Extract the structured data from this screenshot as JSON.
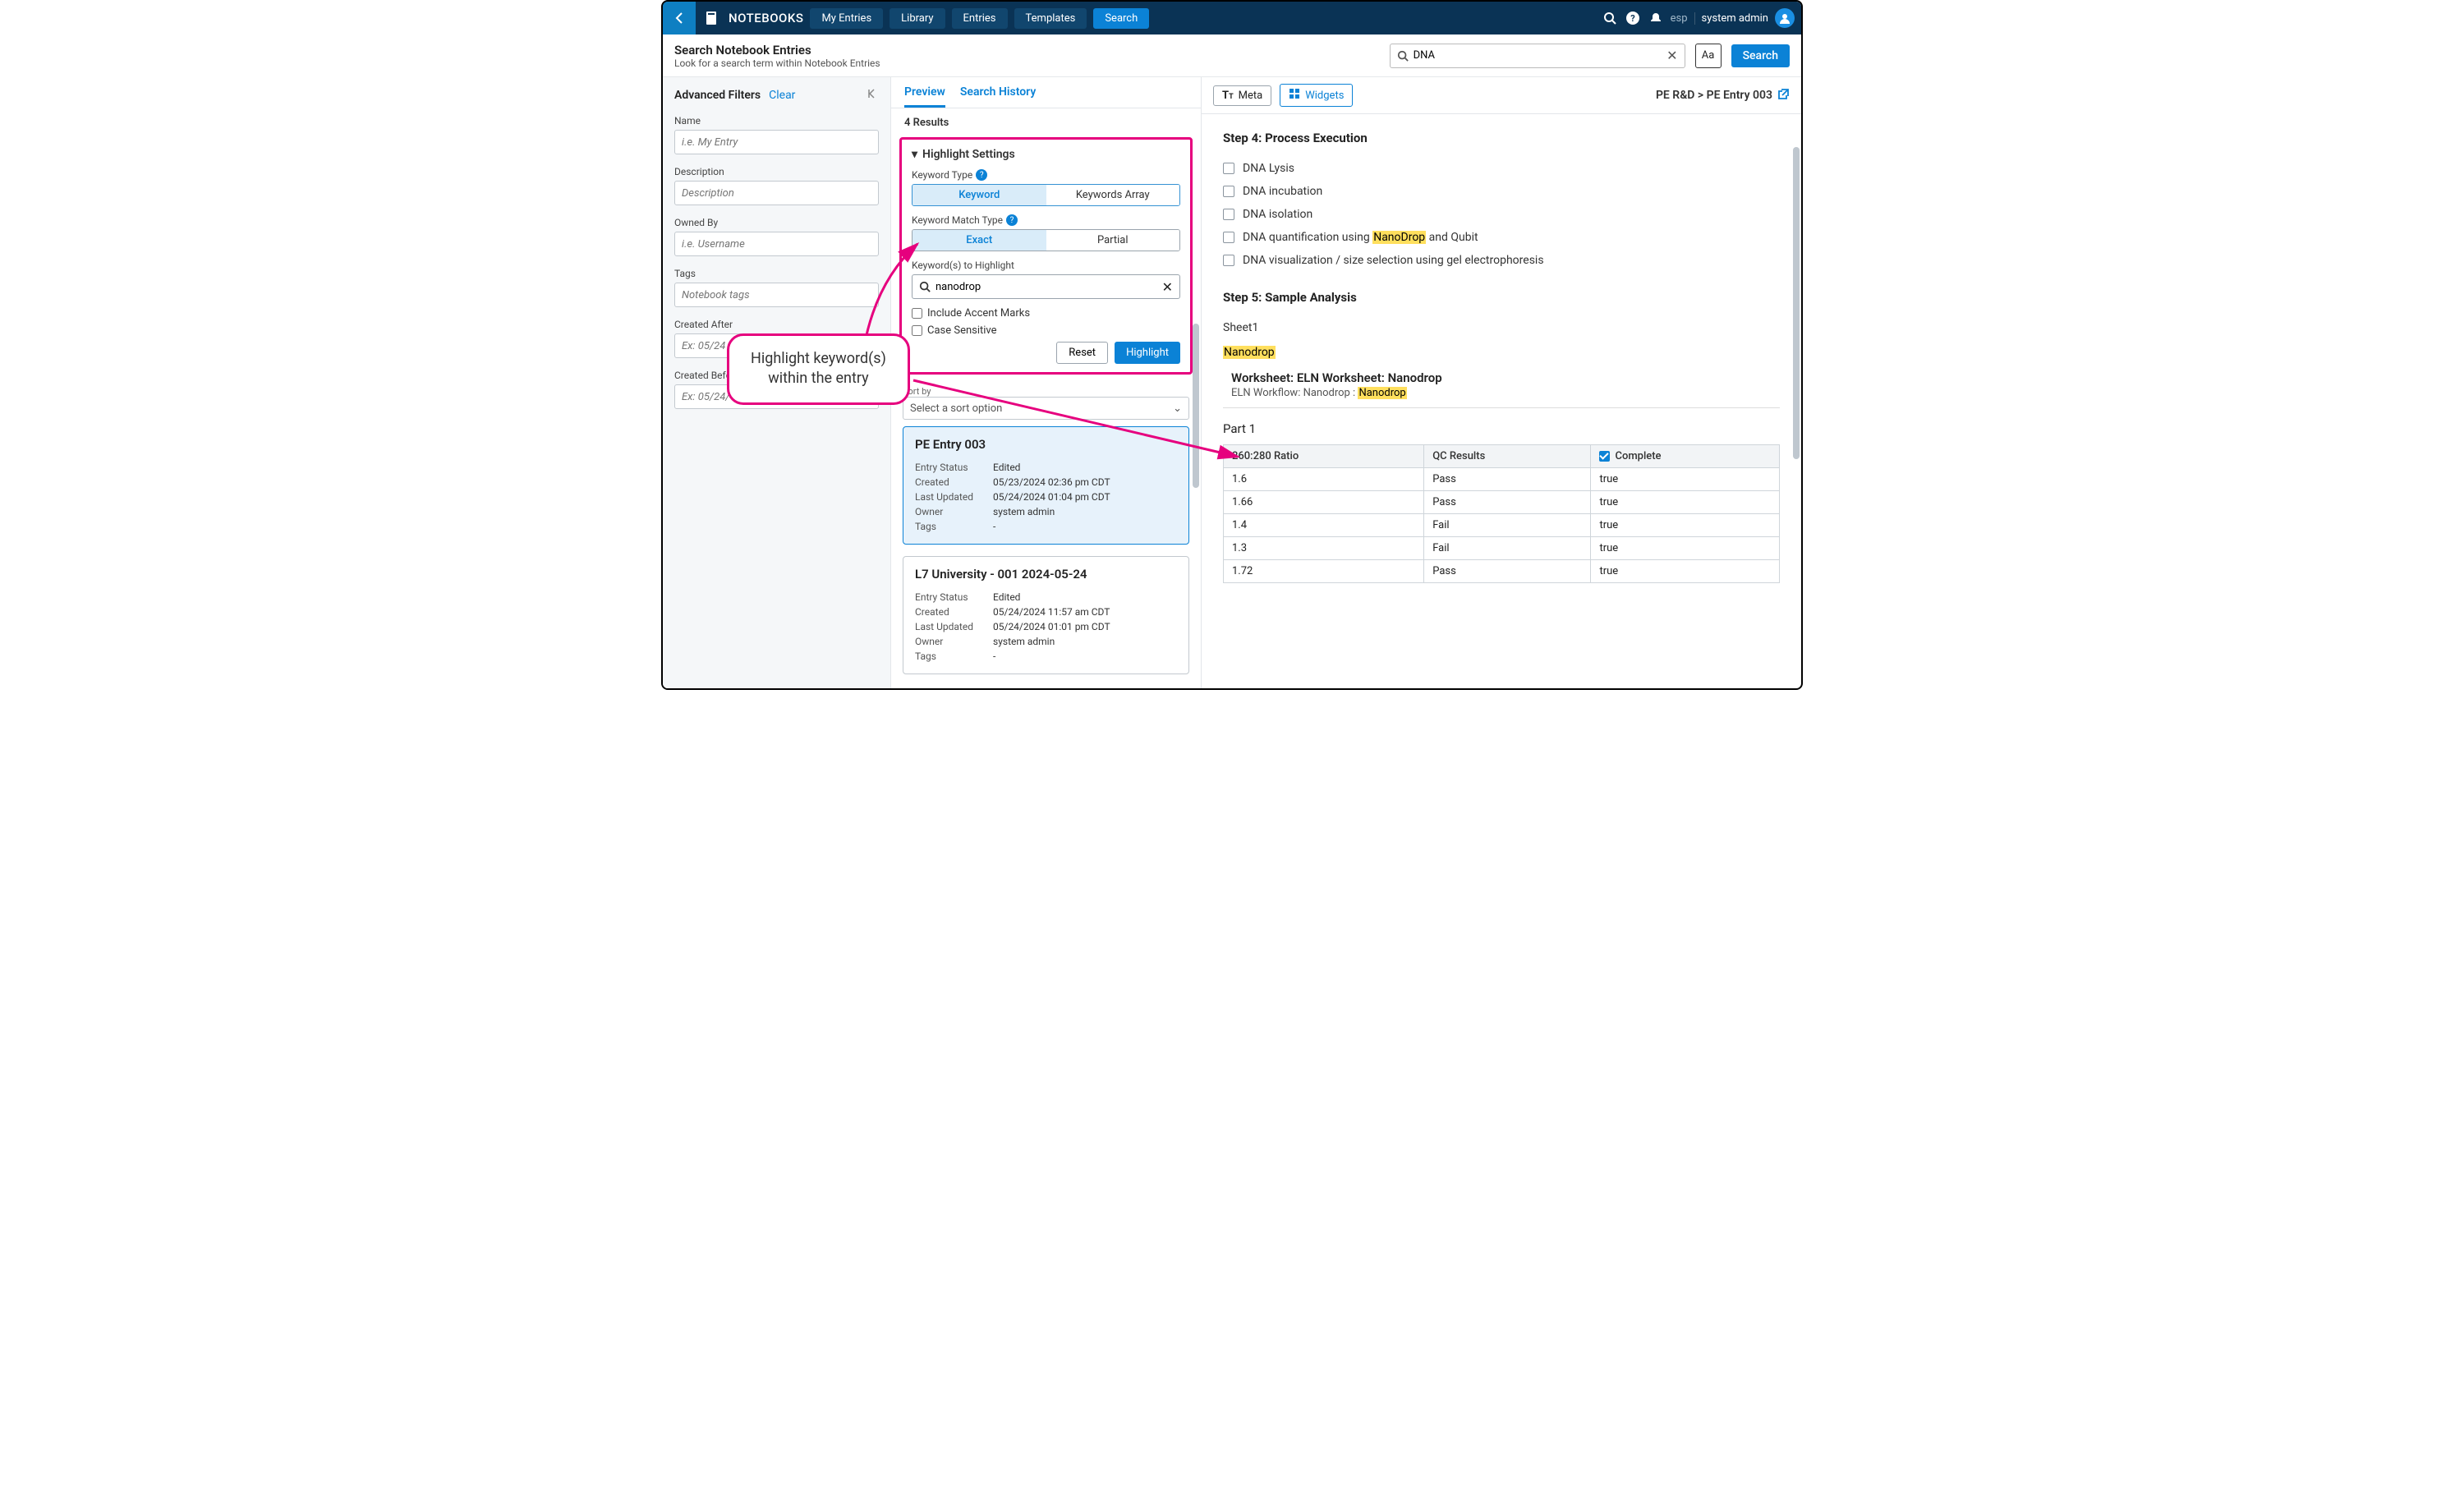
{
  "nav": {
    "brand": "NOTEBOOKS",
    "my_entries": "My Entries",
    "library": "Library",
    "entries": "Entries",
    "templates": "Templates",
    "search": "Search",
    "user_tag": "esp",
    "user_name": "system admin"
  },
  "header": {
    "title": "Search Notebook Entries",
    "sub": "Look for a search term within Notebook Entries",
    "search_value": "DNA",
    "aa": "Aa",
    "search_btn": "Search"
  },
  "filters": {
    "title": "Advanced Filters",
    "clear": "Clear",
    "name_label": "Name",
    "name_ph": "i.e. My Entry",
    "desc_label": "Description",
    "desc_ph": "Description",
    "owned_label": "Owned By",
    "owned_ph": "i.e. Username",
    "tags_label": "Tags",
    "tags_ph": "Notebook tags",
    "created_after_label": "Created After",
    "created_after_ph": "Ex: 05/24",
    "created_before_label": "Created Before",
    "created_before_ph": "Ex: 05/24/"
  },
  "tabs": {
    "preview": "Preview",
    "history": "Search History"
  },
  "results_count": "4 Results",
  "hl": {
    "title": "Highlight Settings",
    "kw_type_label": "Keyword Type",
    "kw": "Keyword",
    "kw_arr": "Keywords Array",
    "match_label": "Keyword Match Type",
    "exact": "Exact",
    "partial": "Partial",
    "to_hl_label": "Keyword(s) to Highlight",
    "to_hl_value": "nanodrop",
    "accent": "Include Accent Marks",
    "case": "Case Sensitive",
    "reset": "Reset",
    "highlight": "Highlight"
  },
  "sort": {
    "label": "Sort by",
    "placeholder": "Select a sort option"
  },
  "cards": [
    {
      "title": "PE Entry 003",
      "rows": [
        [
          "Entry Status",
          "Edited"
        ],
        [
          "Created",
          "05/23/2024 02:36 pm CDT"
        ],
        [
          "Last Updated",
          "05/24/2024 01:04 pm CDT"
        ],
        [
          "Owner",
          "system admin"
        ],
        [
          "Tags",
          "-"
        ]
      ]
    },
    {
      "title": "L7 University - 001 2024-05-24",
      "rows": [
        [
          "Entry Status",
          "Edited"
        ],
        [
          "Created",
          "05/24/2024 11:57 am CDT"
        ],
        [
          "Last Updated",
          "05/24/2024 01:01 pm CDT"
        ],
        [
          "Owner",
          "system admin"
        ],
        [
          "Tags",
          "-"
        ]
      ]
    }
  ],
  "prev_head": {
    "meta": "Meta",
    "widgets": "Widgets",
    "crumb": "PE R&D > PE Entry 003"
  },
  "content": {
    "step4": "Step 4: Process Execution",
    "checks": [
      "DNA Lysis",
      "DNA incubation",
      "DNA isolation",
      "DNA quantification using |NanoDrop| and Qubit",
      "DNA visualization / size selection using gel electrophoresis"
    ],
    "step5": "Step 5: Sample Analysis",
    "sheet": "Sheet1",
    "nano_hl": "Nanodrop",
    "ws_label": "Worksheet: ",
    "ws_name": "ELN Worksheet: Nanodrop",
    "wf_prefix": "ELN Workflow: Nanodrop : ",
    "wf_hl": "Nanodrop",
    "part": "Part 1",
    "columns": [
      "260:280 Ratio",
      "QC Results",
      "Complete"
    ],
    "rows": [
      [
        "1.6",
        "Pass",
        "true"
      ],
      [
        "1.66",
        "Pass",
        "true"
      ],
      [
        "1.4",
        "Fail",
        "true"
      ],
      [
        "1.3",
        "Fail",
        "true"
      ],
      [
        "1.72",
        "Pass",
        "true"
      ]
    ]
  },
  "anno": {
    "l1": "Highlight keyword(s)",
    "l2": "within the entry"
  }
}
